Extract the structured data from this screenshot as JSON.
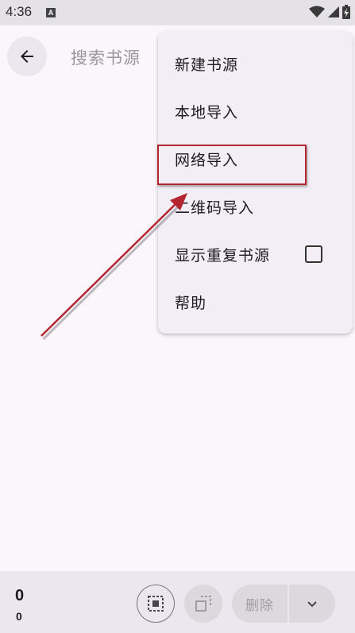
{
  "status_bar": {
    "time": "4:36",
    "notification_icon_letter": "A",
    "icons": [
      "wifi-icon",
      "signal-icon",
      "battery-icon"
    ]
  },
  "toolbar": {
    "back_icon": "arrow-left-icon",
    "search_placeholder": "搜索书源"
  },
  "menu": {
    "items": [
      {
        "label": "新建书源"
      },
      {
        "label": "本地导入"
      },
      {
        "label": "网络导入",
        "highlighted": true
      },
      {
        "label": "二维码导入"
      },
      {
        "label": "显示重复书源",
        "checkbox": true,
        "checked": false
      },
      {
        "label": "帮助"
      }
    ]
  },
  "bottom_bar": {
    "selected_count": "0",
    "total_count": "0",
    "select_all_icon": "select-all-icon",
    "invert_select_icon": "invert-selection-icon",
    "delete_label": "删除",
    "more_icon": "chevron-down-icon"
  },
  "colors": {
    "background": "#fbf6fc",
    "menu_background": "#f3eef6",
    "annotation_red": "#b3262f"
  }
}
